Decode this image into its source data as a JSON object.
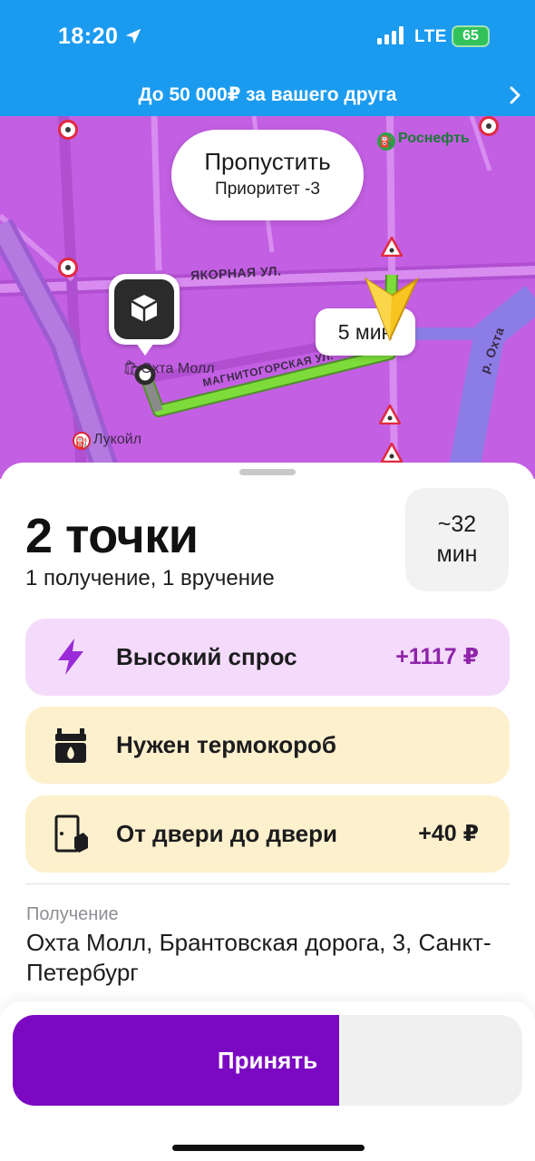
{
  "status_bar": {
    "time": "18:20",
    "network": "LTE",
    "battery": "65"
  },
  "promo": {
    "text": "До 50 000₽ за вашего друга"
  },
  "map": {
    "skip_title": "Пропустить",
    "skip_subtitle": "Приоритет -3",
    "eta": "5 мин",
    "streets": [
      "ЯКОРНАЯ УЛ.",
      "МАГНИТОГОРСКАЯ УЛ."
    ],
    "river": "р. Охта",
    "pois": {
      "rosneft": "Роснефть",
      "okhta_mall": "Охта Молл",
      "lukoil": "Лукойл"
    },
    "colors": {
      "background": "#c35fe3",
      "route": "#7ddc3a"
    }
  },
  "order": {
    "title": "2 точки",
    "subtitle": "1 получение, 1 вручение",
    "time_value": "~32",
    "time_unit": "мин",
    "features": [
      {
        "icon": "lightning-icon",
        "label": "Высокий спрос",
        "value": "+1117 ₽"
      },
      {
        "icon": "thermo-box-icon",
        "label": "Нужен термокороб",
        "value": ""
      },
      {
        "icon": "door-icon",
        "label": "От двери до двери",
        "value": "+40 ₽"
      }
    ],
    "pickup_caption": "Получение",
    "pickup_address": "Охта Молл, Брантовская дорога, 3, Санкт-Петербург"
  },
  "accept": {
    "label": "Принять",
    "progress": 0.64,
    "color": "#7b09c2"
  }
}
